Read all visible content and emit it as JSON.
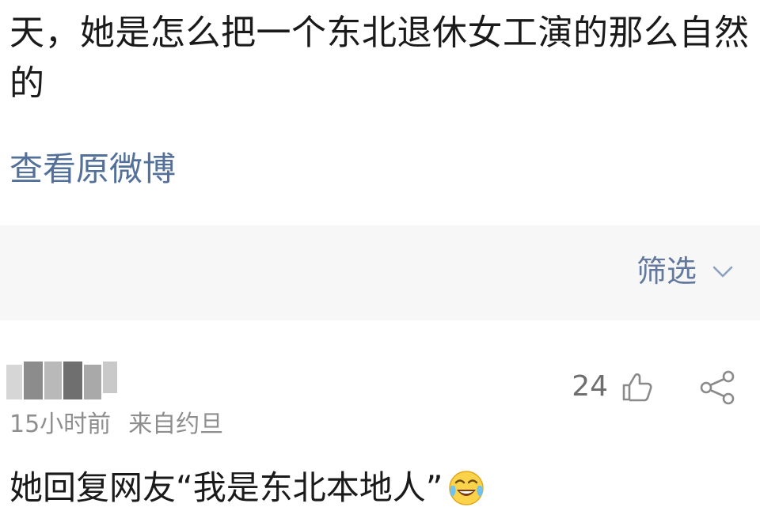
{
  "post": {
    "text": "天，她是怎么把一个东北退休女工演的那么自然的",
    "view_original": "查看原微博"
  },
  "filter": {
    "label": "筛选",
    "icon": "chevron-down-icon",
    "color": "#62789e"
  },
  "comment": {
    "time": "15小时前",
    "source": "来自约旦",
    "likes": "24",
    "like_icon": "thumbs-up-icon",
    "share_icon": "share-icon",
    "text": "她回复网友“我是东北本地人”",
    "emoji": "laugh-cry-emoji"
  },
  "colors": {
    "link": "#52709a",
    "meta": "#8e8e8e",
    "band": "#f7f7f7"
  }
}
